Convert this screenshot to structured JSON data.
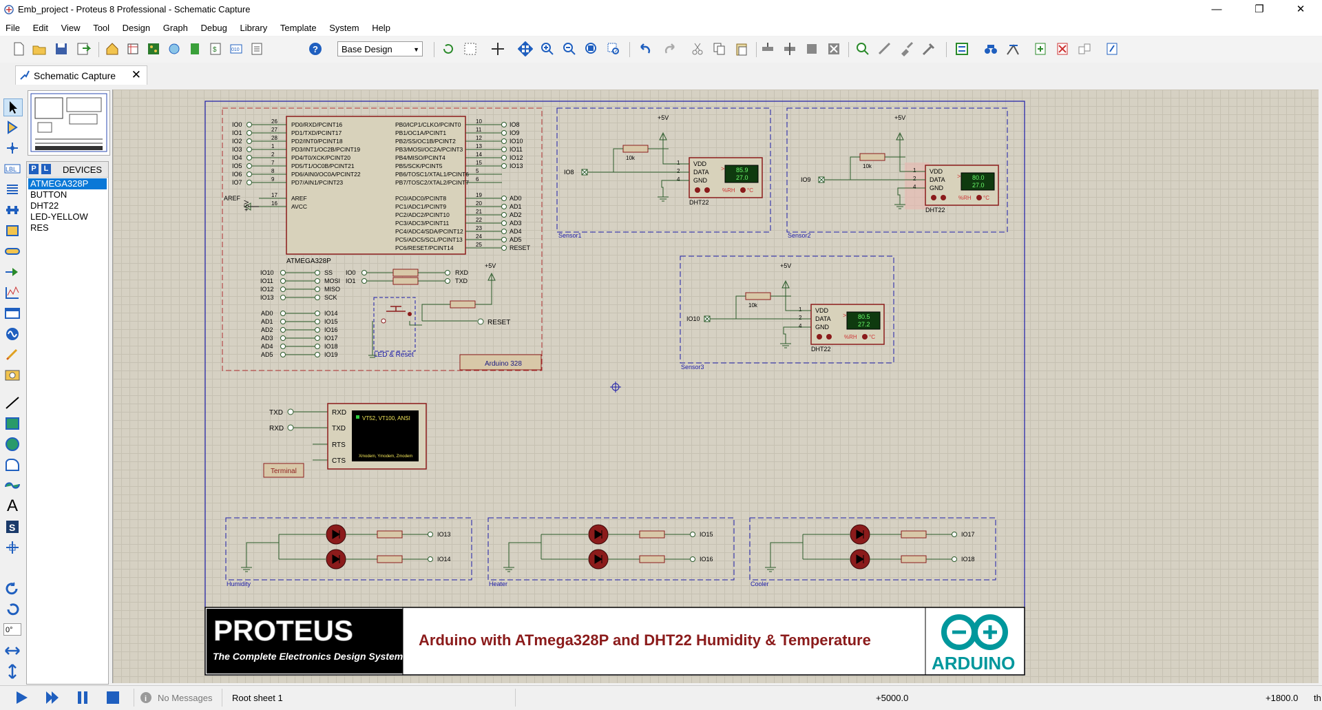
{
  "window": {
    "title": "Emb_project - Proteus 8 Professional - Schematic Capture",
    "minimize": "—",
    "restore": "❐",
    "close": "✕"
  },
  "menu": [
    "File",
    "Edit",
    "View",
    "Tool",
    "Design",
    "Graph",
    "Debug",
    "Library",
    "Template",
    "System",
    "Help"
  ],
  "toolbar": {
    "design_select": "Base Design"
  },
  "tabs": [
    {
      "label": "Schematic Capture",
      "close": "✕"
    }
  ],
  "devices": {
    "header_p": "P",
    "header_l": "L",
    "title": "DEVICES",
    "items": [
      "ATMEGA328P",
      "BUTTON",
      "DHT22",
      "LED-YELLOW",
      "RES"
    ],
    "selected": "ATMEGA328P"
  },
  "rotation_value": "0°",
  "schematic": {
    "mcu": {
      "name": "ATMEGA328P",
      "left_pins": [
        {
          "net": "IO0",
          "num": "26",
          "label": "PD0/RXD/PCINT16"
        },
        {
          "net": "IO1",
          "num": "27",
          "label": "PD1/TXD/PCINT17"
        },
        {
          "net": "IO2",
          "num": "28",
          "label": "PD2/INT0/PCINT18"
        },
        {
          "net": "IO3",
          "num": "1",
          "label": "PD3/INT1/OC2B/PCINT19"
        },
        {
          "net": "IO4",
          "num": "2",
          "label": "PD4/T0/XCK/PCINT20"
        },
        {
          "net": "IO5",
          "num": "7",
          "label": "PD5/T1/OC0B/PCINT21"
        },
        {
          "net": "IO6",
          "num": "8",
          "label": "PD6/AIN0/OC0A/PCINT22"
        },
        {
          "net": "IO7",
          "num": "9",
          "label": "PD7/AIN1/PCINT23"
        }
      ],
      "right_pins_b": [
        {
          "net": "IO8",
          "num": "10",
          "label": "PB0/ICP1/CLKO/PCINT0"
        },
        {
          "net": "IO9",
          "num": "11",
          "label": "PB1/OC1A/PCINT1"
        },
        {
          "net": "IO10",
          "num": "12",
          "label": "PB2/SS/OC1B/PCINT2"
        },
        {
          "net": "IO11",
          "num": "13",
          "label": "PB3/MOSI/OC2A/PCINT3"
        },
        {
          "net": "IO12",
          "num": "14",
          "label": "PB4/MISO/PCINT4"
        },
        {
          "net": "IO13",
          "num": "15",
          "label": "PB5/SCK/PCINT5"
        },
        {
          "net": "",
          "num": "5",
          "label": "PB6/TOSC1/XTAL1/PCINT6"
        },
        {
          "net": "",
          "num": "6",
          "label": "PB7/TOSC2/XTAL2/PCINT7"
        }
      ],
      "right_pins_c": [
        {
          "net": "AD0",
          "num": "19",
          "label": "PC0/ADC0/PCINT8"
        },
        {
          "net": "AD1",
          "num": "20",
          "label": "PC1/ADC1/PCINT9"
        },
        {
          "net": "AD2",
          "num": "21",
          "label": "PC2/ADC2/PCINT10"
        },
        {
          "net": "AD3",
          "num": "22",
          "label": "PC3/ADC3/PCINT11"
        },
        {
          "net": "AD4",
          "num": "23",
          "label": "PC4/ADC4/SDA/PCINT12"
        },
        {
          "net": "AD5",
          "num": "24",
          "label": "PC5/ADC5/SCL/PCINT13"
        },
        {
          "net": "RESET",
          "num": "25",
          "label": "PC6/RESET/PCINT14"
        }
      ],
      "power_pins": [
        {
          "net": "AREF",
          "num": "17",
          "label": "AREF"
        },
        {
          "net": "+5V",
          "num": "16",
          "label": "AVCC"
        }
      ]
    },
    "spi_map": [
      {
        "from": "IO10",
        "to": "SS"
      },
      {
        "from": "IO11",
        "to": "MOSI"
      },
      {
        "from": "IO12",
        "to": "MISO"
      },
      {
        "from": "IO13",
        "to": "SCK"
      }
    ],
    "uart_map": [
      {
        "from": "IO0",
        "to": "RXD"
      },
      {
        "from": "IO1",
        "to": "TXD"
      }
    ],
    "analog_map": [
      {
        "from": "AD0",
        "to": "IO14"
      },
      {
        "from": "AD1",
        "to": "IO15"
      },
      {
        "from": "AD2",
        "to": "IO16"
      },
      {
        "from": "AD3",
        "to": "IO17"
      },
      {
        "from": "AD4",
        "to": "IO18"
      },
      {
        "from": "AD5",
        "to": "IO19"
      }
    ],
    "reset_label": "RESET",
    "plus5v": "+5V",
    "led_reset_label": "LED & Reset",
    "arduino_label": "Arduino 328",
    "sensors": [
      {
        "group": "Sensor1",
        "io": "IO8",
        "res": "10k",
        "part": "DHT22",
        "hum": "85.9",
        "temp": "27.0",
        "rh": "%RH",
        "deg": "°C",
        "pins": [
          "VDD",
          "DATA",
          "GND"
        ],
        "nums": [
          "1",
          "2",
          "4"
        ]
      },
      {
        "group": "Sensor2",
        "io": "IO9",
        "res": "10k",
        "part": "DHT22",
        "hum": "80.0",
        "temp": "27.0",
        "rh": "%RH",
        "deg": "°C",
        "pins": [
          "VDD",
          "DATA",
          "GND"
        ],
        "nums": [
          "1",
          "2",
          "4"
        ]
      },
      {
        "group": "Sensor3",
        "io": "IO10",
        "res": "10k",
        "part": "DHT22",
        "hum": "80.5",
        "temp": "27.2",
        "rh": "%RH",
        "deg": "°C",
        "pins": [
          "VDD",
          "DATA",
          "GND"
        ],
        "nums": [
          "1",
          "2",
          "4"
        ]
      }
    ],
    "terminal": {
      "in_txd": "TXD",
      "in_rxd": "RXD",
      "pins": [
        "RXD",
        "TXD",
        "RTS",
        "CTS"
      ],
      "screen_title": "VT52, VT100, ANSI",
      "screen_sub": "Xmodem, Ymodem, Zmodem",
      "label": "Terminal"
    },
    "led_groups": [
      {
        "name": "Humidity",
        "outputs": [
          "IO13",
          "IO14"
        ]
      },
      {
        "name": "Heater",
        "outputs": [
          "IO15",
          "IO16"
        ]
      },
      {
        "name": "Cooler",
        "outputs": [
          "IO17",
          "IO18"
        ]
      }
    ],
    "title_block": {
      "logo_text": "PROTEUS",
      "logo_sub": "The Complete Electronics Design System",
      "title": "Arduino with ATmega328P and DHT22 Humidity & Temperature",
      "arduino_logo": "ARDUINO"
    }
  },
  "status": {
    "messages": "No Messages",
    "sheet": "Root sheet 1",
    "x_coord": "+5000.0",
    "y_coord": "+1800.0",
    "units": "th"
  }
}
